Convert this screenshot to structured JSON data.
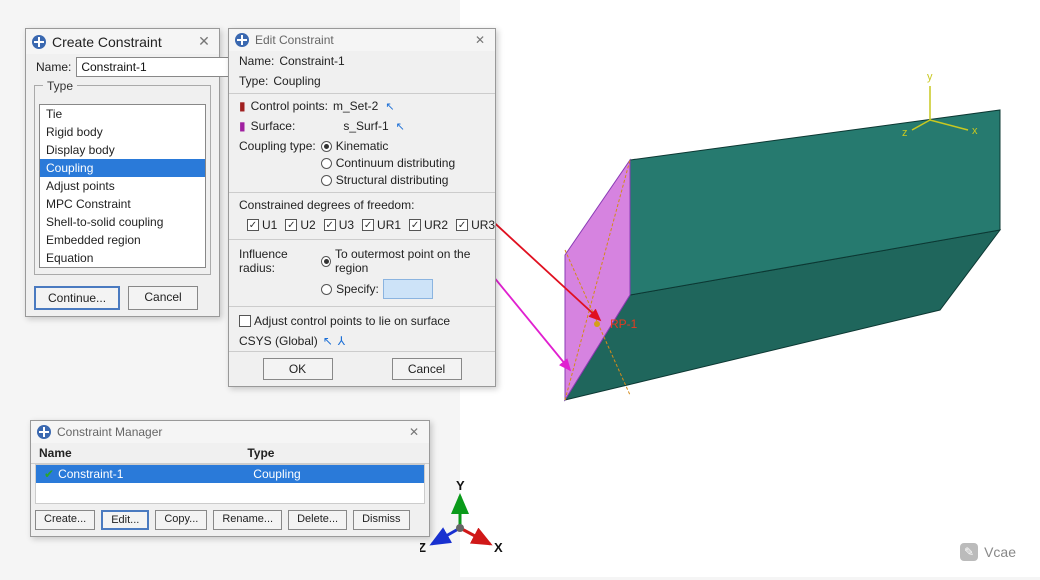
{
  "create_dialog": {
    "title": "Create Constraint",
    "name_label": "Name:",
    "name_value": "Constraint-1",
    "type_label": "Type",
    "types": [
      "Tie",
      "Rigid body",
      "Display body",
      "Coupling",
      "Adjust points",
      "MPC Constraint",
      "Shell-to-solid coupling",
      "Embedded region",
      "Equation"
    ],
    "selected_type_index": 3,
    "continue_btn": "Continue...",
    "cancel_btn": "Cancel"
  },
  "edit_dialog": {
    "title": "Edit Constraint",
    "name_label": "Name:",
    "name_value": "Constraint-1",
    "type_label": "Type:",
    "type_value": "Coupling",
    "control_points_label": "Control points:",
    "control_points_value": "m_Set-2",
    "surface_label": "Surface:",
    "surface_value": "s_Surf-1",
    "coupling_type_label": "Coupling type:",
    "coupling_options": [
      "Kinematic",
      "Continuum distributing",
      "Structural distributing"
    ],
    "coupling_selected": 0,
    "dof_label": "Constrained degrees of freedom:",
    "dofs": [
      "U1",
      "U2",
      "U3",
      "UR1",
      "UR2",
      "UR3"
    ],
    "influence_label": "Influence radius:",
    "influence_options": [
      "To outermost point on the region",
      "Specify:"
    ],
    "influence_selected": 0,
    "specify_value": "",
    "adjust_label": "Adjust control points to lie on surface",
    "adjust_checked": false,
    "csys_label": "CSYS (Global)",
    "ok_btn": "OK",
    "cancel_btn": "Cancel"
  },
  "manager": {
    "title": "Constraint Manager",
    "col_name": "Name",
    "col_type": "Type",
    "rows": [
      {
        "name": "Constraint-1",
        "type": "Coupling"
      }
    ],
    "buttons": [
      "Create...",
      "Edit...",
      "Copy...",
      "Rename...",
      "Delete...",
      "Dismiss"
    ],
    "default_button_index": 1
  },
  "viewport": {
    "rp_label": "RP-1",
    "axes_small": {
      "x": "X",
      "y": "Y",
      "z": "Z"
    },
    "axes_model": {
      "x": "x",
      "y": "y",
      "z": "z"
    }
  },
  "watermark": {
    "text": "Vcae"
  }
}
